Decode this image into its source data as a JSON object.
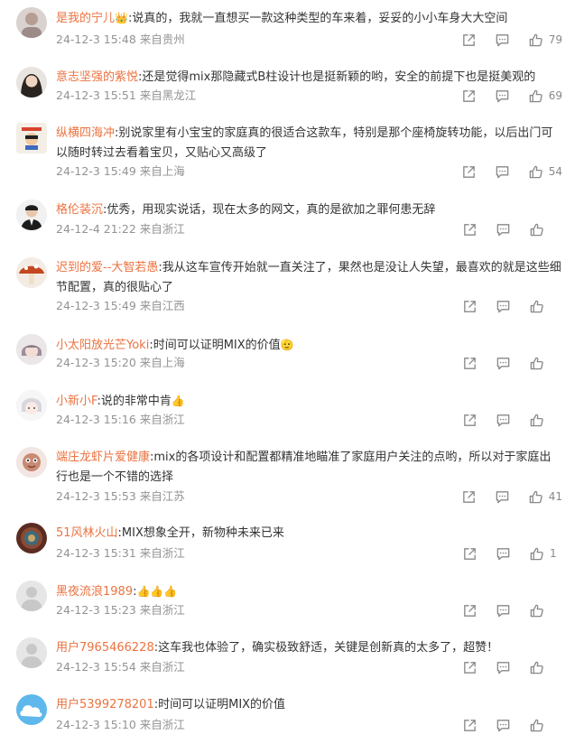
{
  "comments": [
    {
      "user": "是我的宁儿",
      "badge": "👑",
      "text": ":说真的，我就一直想买一款这种类型的车来着，妥妥的小小车身大大空间",
      "time": "24-12-3 15:48",
      "location": "来自贵州",
      "likes": "79"
    },
    {
      "user": "意志坚强的紫悦",
      "badge": "",
      "text": ":还是觉得mix那隐藏式B柱设计也是挺新颖的哟，安全的前提下也是挺美观的",
      "time": "24-12-3 15:51",
      "location": "来自黑龙江",
      "likes": "69"
    },
    {
      "user": "纵横四海冲",
      "badge": "",
      "text": ":别说家里有小宝宝的家庭真的很适合这款车，特别是那个座椅旋转功能，以后出门可以随时转过去看着宝贝，又贴心又高级了",
      "time": "24-12-3 15:49",
      "location": "来自上海",
      "likes": "54"
    },
    {
      "user": "格伦装沉",
      "badge": "",
      "text": ":优秀，用现实说话，现在太多的网文，真的是欲加之罪何患无辞",
      "time": "24-12-4 21:22",
      "location": "来自浙江",
      "likes": ""
    },
    {
      "user": "迟到的爱--大智若愚",
      "badge": "",
      "text": ":我从这车宣传开始就一直关注了，果然也是没让人失望，最喜欢的就是这些细节配置，真的很贴心了",
      "time": "24-12-3 15:49",
      "location": "来自江西",
      "likes": ""
    },
    {
      "user": "小太阳放光芒Yoki",
      "badge": "",
      "text": ":时间可以证明MIX的价值",
      "emoji": "🫡",
      "time": "24-12-3 15:20",
      "location": "来自上海",
      "likes": ""
    },
    {
      "user": "小新小F",
      "badge": "",
      "text": ":说的非常中肯",
      "emoji": "👍",
      "time": "24-12-3 15:16",
      "location": "来自浙江",
      "likes": ""
    },
    {
      "user": "端庄龙虾片爱健康",
      "badge": "",
      "text": ":mix的各项设计和配置都精准地瞄准了家庭用户关注的点哟，所以对于家庭出行也是一个不错的选择",
      "time": "24-12-3 15:53",
      "location": "来自江苏",
      "likes": "41"
    },
    {
      "user": "51风林火山",
      "badge": "",
      "text": ":MIX想象全开，新物种未来已来",
      "time": "24-12-3 15:31",
      "location": "来自浙江",
      "likes": "1"
    },
    {
      "user": "黑夜流浪1989",
      "badge": "",
      "text": ":",
      "emoji": "👍👍👍",
      "time": "24-12-3 15:23",
      "location": "来自浙江",
      "likes": ""
    },
    {
      "user": "用户7965466228",
      "badge": "",
      "text": ":这车我也体验了，确实极致舒适，关键是创新真的太多了，超赞！",
      "time": "24-12-3 15:54",
      "location": "来自浙江",
      "likes": ""
    },
    {
      "user": "用户5399278201",
      "badge": "",
      "text": ":时间可以证明MIX的价值",
      "time": "24-12-3 15:10",
      "location": "来自浙江",
      "likes": ""
    }
  ]
}
